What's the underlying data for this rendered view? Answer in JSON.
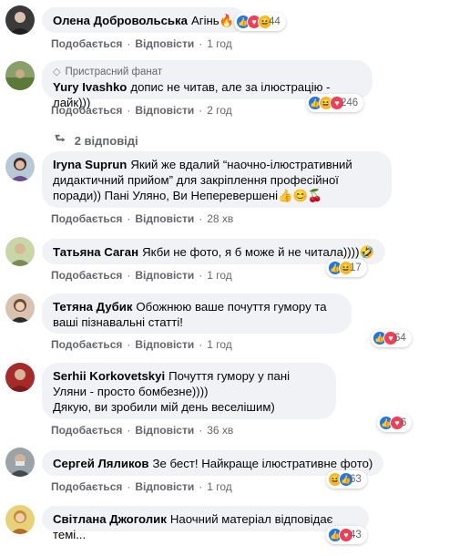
{
  "comments": [
    {
      "author": "Олена Добровольська",
      "text": "Агінь🔥",
      "like_label": "Подобається",
      "reply_label": "Відповісти",
      "time": "1 год",
      "reaction_count": "44",
      "reactions": [
        "like-icon",
        "love-icon",
        "haha-icon"
      ]
    },
    {
      "badge": "Пристрасний фанат",
      "author": "Yury Ivashko",
      "text": "допис не читав, але за ілюстрацію - лайк)))",
      "like_label": "Подобається",
      "reply_label": "Відповісти",
      "time": "2 год",
      "reaction_count": "246",
      "reactions": [
        "like-icon",
        "haha-icon",
        "love-icon"
      ]
    },
    {
      "author": "Iryna Suprun",
      "text": "Який же вдалий “наочно-ілюстративний дидактичний прийом” для закріплення професійної поради)) Пані Уляно, Ви Неперевершені👍😊🍒",
      "like_label": "Подобається",
      "reply_label": "Відповісти",
      "time": "28 хв"
    },
    {
      "author": "Татьяна Саган",
      "text": "Якби не фото, я б може й не читала))))🤣",
      "like_label": "Подобається",
      "reply_label": "Відповісти",
      "time": "1 год",
      "reaction_count": "17",
      "reactions": [
        "like-icon",
        "haha-icon"
      ]
    },
    {
      "author": "Тетяна Дубик",
      "text": "Обожнюю ваше почуття гумору та ваші пізнавальні статті!",
      "like_label": "Подобається",
      "reply_label": "Відповісти",
      "time": "1 год",
      "reaction_count": "64",
      "reactions": [
        "like-icon",
        "love-icon"
      ]
    },
    {
      "author": "Serhii Korkovetskyi",
      "text": "Почуття гумору у пані Уляни - просто бомбезне))))",
      "text2": "Дякую, ви зробили мій день веселішим)",
      "like_label": "Подобається",
      "reply_label": "Відповісти",
      "time": "36 хв",
      "reaction_count": "6",
      "reactions": [
        "like-icon",
        "love-icon"
      ]
    },
    {
      "author": "Сергей Ляликов",
      "text": "Зе бест! Найкраще ілюстративне фото)",
      "like_label": "Подобається",
      "reply_label": "Відповісти",
      "time": "1 год",
      "reaction_count": "63",
      "reactions": [
        "haha-icon",
        "like-icon"
      ]
    },
    {
      "author": "Світлана Джоголик",
      "text": "Наочний матеріал відповідає темі...",
      "reaction_count": "43",
      "reactions": [
        "like-icon",
        "love-icon"
      ]
    }
  ],
  "replies_label": "2 відповіді",
  "colors": {
    "bubble": "#f0f2f5",
    "meta": "#65676b",
    "like": "#1877f2",
    "love": "#f33e58",
    "haha": "#f7b928"
  }
}
